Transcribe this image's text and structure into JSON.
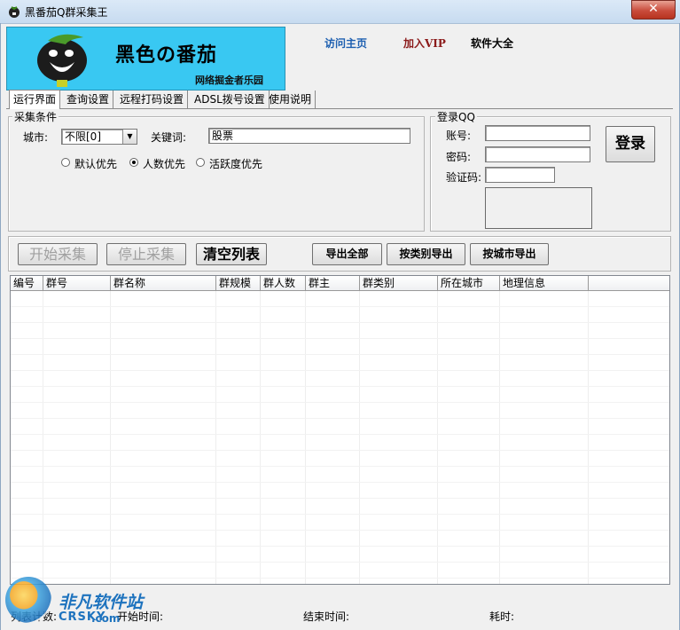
{
  "window": {
    "title": "黑番茄Q群采集王",
    "close_label": "✕"
  },
  "banner": {
    "title": "黑色の番茄",
    "subtitle": "网络掘金者乐园"
  },
  "toplinks": [
    {
      "label": "访问主页",
      "color": "#1d5fb0"
    },
    {
      "label": "加入VIP",
      "color": "#8b1a1a"
    },
    {
      "label": "软件大全",
      "color": "#000000"
    }
  ],
  "tabs": [
    "运行界面",
    "查询设置",
    "远程打码设置",
    "ADSL拨号设置",
    "使用说明"
  ],
  "collect": {
    "legend": "采集条件",
    "city_label": "城市:",
    "city_value": "不限[0]",
    "keyword_label": "关键词:",
    "keyword_value": "股票",
    "radios": [
      {
        "label": "默认优先",
        "selected": false
      },
      {
        "label": "人数优先",
        "selected": true
      },
      {
        "label": "活跃度优先",
        "selected": false
      }
    ]
  },
  "login": {
    "legend": "登录QQ",
    "account_label": "账号:",
    "password_label": "密码:",
    "captcha_label": "验证码:",
    "login_button": "登录"
  },
  "actions": {
    "start": "开始采集",
    "stop": "停止采集",
    "clear": "清空列表",
    "export_all": "导出全部",
    "export_category": "按类别导出",
    "export_city": "按城市导出"
  },
  "table": {
    "columns": [
      "编号",
      "群号",
      "群名称",
      "群规模",
      "群人数",
      "群主",
      "群类别",
      "所在城市",
      "地理信息"
    ]
  },
  "status": {
    "count_label": "列表计数:",
    "start_label": "开始时间:",
    "end_label": "结束时间:",
    "elapsed_label": "耗时:"
  },
  "watermark": {
    "cn": "非凡软件站",
    "en": "CRSKY",
    "suffix": ".com"
  }
}
